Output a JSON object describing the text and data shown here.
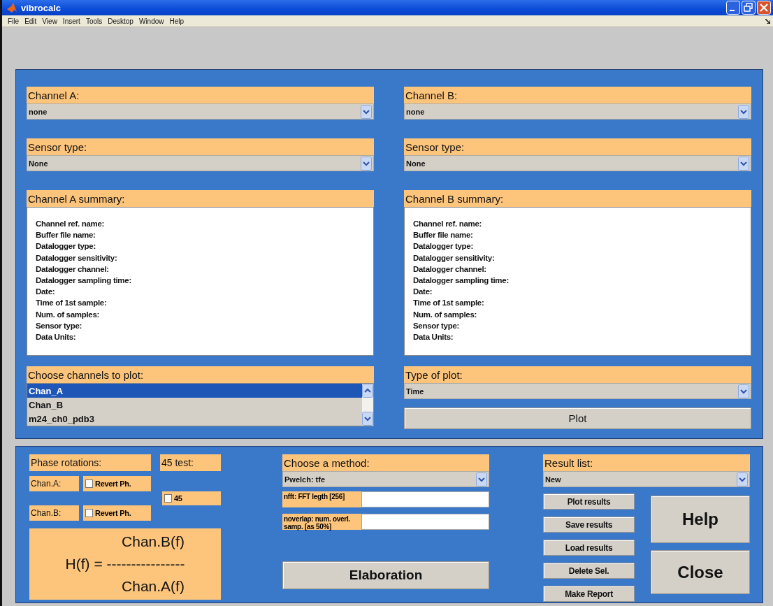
{
  "window": {
    "title": "vibrocalc"
  },
  "menu": [
    "File",
    "Edit",
    "View",
    "Insert",
    "Tools",
    "Desktop",
    "Window",
    "Help"
  ],
  "channel_a": {
    "label": "Channel A:",
    "value": "none"
  },
  "channel_b": {
    "label": "Channel B:",
    "value": "none"
  },
  "sensor_a": {
    "label": "Sensor type:",
    "value": "None"
  },
  "sensor_b": {
    "label": "Sensor type:",
    "value": "None"
  },
  "summary_a": {
    "label": "Channel A summary:",
    "lines": [
      "Channel ref. name:",
      "Buffer file name:",
      "Datalogger type:",
      "Datalogger sensitivity:",
      "Datalogger channel:",
      "Datalogger sampling time:",
      "Date:",
      "Time of 1st sample:",
      "Num. of samples:",
      "Sensor type:",
      "Data Units:"
    ]
  },
  "summary_b": {
    "label": "Channel B summary:",
    "lines": [
      "Channel ref. name:",
      "Buffer file name:",
      "Datalogger type:",
      "Datalogger sensitivity:",
      "Datalogger channel:",
      "Datalogger sampling time:",
      "Date:",
      "Time of 1st sample:",
      "Num. of samples:",
      "Sensor type:",
      "Data Units:"
    ]
  },
  "channels_to_plot": {
    "label": "Choose channels to plot:",
    "items": [
      {
        "text": "Chan_A",
        "selected": true
      },
      {
        "text": "Chan_B",
        "selected": false
      },
      {
        "text": "m24_ch0_pdb3",
        "selected": false
      }
    ]
  },
  "type_of_plot": {
    "label": "Type of plot:",
    "value": "Time"
  },
  "plot_button": "Plot",
  "phase_rotations": {
    "label": "Phase rotations:",
    "chan_a_label": "Chan.A:",
    "chan_b_label": "Chan.B:",
    "chan_a_option": {
      "label": "Revert Ph.",
      "checked": false
    },
    "chan_b_option": {
      "label": "Revert Ph.",
      "checked": false
    }
  },
  "test": {
    "label": "45 test:",
    "option": {
      "label": "45",
      "checked": false
    }
  },
  "formula": {
    "numerator": "Chan.B(f)",
    "equation": "H(f) = ----------------",
    "denominator": "Chan.A(f)"
  },
  "method": {
    "label": "Choose a method:",
    "value": "Pwelch: tfe",
    "params": [
      {
        "label": "nfft: FFT legth [256]"
      },
      {
        "label": "noverlap: num. overl. samp. [as 50%]"
      }
    ]
  },
  "elaboration_button": "Elaboration",
  "results": {
    "label": "Result list:",
    "value": "New",
    "buttons": [
      "Plot results",
      "Save results",
      "Load results",
      "Delete Sel.",
      "Make Report"
    ]
  },
  "help_button": "Help",
  "close_button": "Close"
}
